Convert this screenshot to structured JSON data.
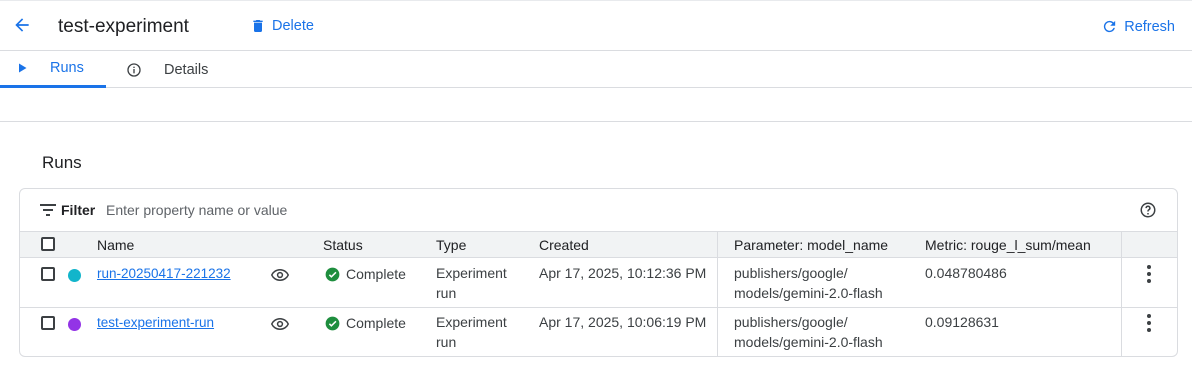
{
  "header": {
    "title": "test-experiment",
    "delete_label": "Delete",
    "refresh_label": "Refresh"
  },
  "tabs": [
    {
      "label": "Runs",
      "active": true
    },
    {
      "label": "Details",
      "active": false
    }
  ],
  "section": {
    "title": "Runs"
  },
  "filter": {
    "label": "Filter",
    "placeholder": "Enter property name or value"
  },
  "columns": {
    "name": "Name",
    "status": "Status",
    "type": "Type",
    "created": "Created",
    "param": "Parameter: model_name",
    "metric": "Metric: rouge_l_sum/mean"
  },
  "rows": [
    {
      "name": "run-20250417-221232",
      "color": "#12b5cb",
      "status": "Complete",
      "type_line1": "Experiment",
      "type_line2": "run",
      "created": "Apr 17, 2025, 10:12:36 PM",
      "param_line1": "publishers/google/",
      "param_line2": "models/gemini-2.0-flash",
      "metric": "0.048780486"
    },
    {
      "name": "test-experiment-run",
      "color": "#9334e6",
      "status": "Complete",
      "type_line1": "Experiment",
      "type_line2": "run",
      "created": "Apr 17, 2025, 10:06:19 PM",
      "param_line1": "publishers/google/",
      "param_line2": "models/gemini-2.0-flash",
      "metric": "0.09128631"
    }
  ],
  "colors": {
    "accent": "#1a73e8",
    "success": "#1e8e3e"
  }
}
